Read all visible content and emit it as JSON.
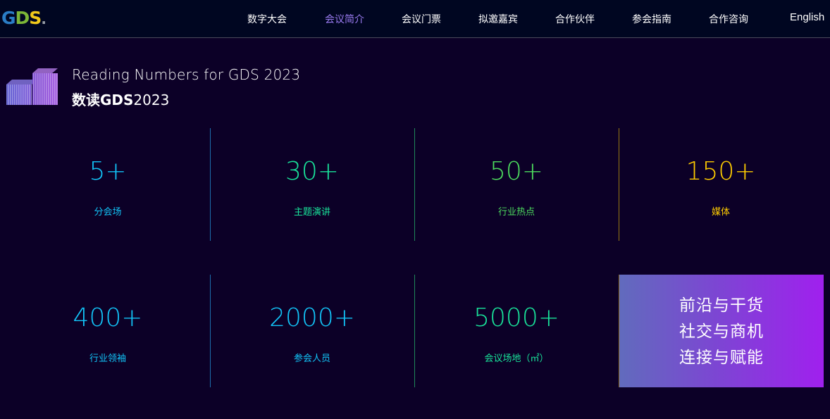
{
  "header": {
    "logo": {
      "g": "G",
      "d": "D",
      "s": "S",
      "dot": ".",
      "colors": {
        "g": "#2a7dc6",
        "d": "#7cb637",
        "s": "#f1c91b",
        "dot": "#9aa0a8"
      }
    },
    "nav": [
      {
        "label": "数字大会",
        "active": false
      },
      {
        "label": "会议简介",
        "active": true
      },
      {
        "label": "会议门票",
        "active": false
      },
      {
        "label": "拟邀嘉宾",
        "active": false
      },
      {
        "label": "合作伙伴",
        "active": false
      },
      {
        "label": "参会指南",
        "active": false
      },
      {
        "label": "合作咨询",
        "active": false
      },
      {
        "label": "English",
        "active": false
      }
    ],
    "active_color": "#9b7cf2"
  },
  "section": {
    "icon": "bar-chart-3d-icon",
    "title_en": "Reading Numbers for GDS 2023",
    "title_zh_prefix": "数读",
    "title_zh_bold": "GDS",
    "title_zh_suffix": "2023"
  },
  "stats": [
    {
      "value": "5+",
      "label": "分会场",
      "color": "#12c4f8",
      "divider_color": "#1e6fae"
    },
    {
      "value": "30+",
      "label": "主题演讲",
      "color": "#19e39a",
      "divider_color": "#1f8a5a"
    },
    {
      "value": "50+",
      "label": "行业热点",
      "color": "#4ddc5e",
      "divider_color": "#9a7a12"
    },
    {
      "value": "150+",
      "label": "媒体",
      "color": "#ffcc00"
    },
    {
      "value": "400+",
      "label": "行业领袖",
      "color": "#12c4f8",
      "divider_color": "#1e6fae"
    },
    {
      "value": "2000+",
      "label": "参会人员",
      "color": "#12c4f8",
      "divider_color": "#1f8a5a"
    },
    {
      "value": "5000+",
      "label": "会议场地（㎡）",
      "color": "#19e39a"
    }
  ],
  "promo": {
    "lines": [
      "前沿与干货",
      "社交与商机",
      "连接与赋能"
    ],
    "gradient": [
      "#616bbd",
      "#a020ee"
    ]
  }
}
